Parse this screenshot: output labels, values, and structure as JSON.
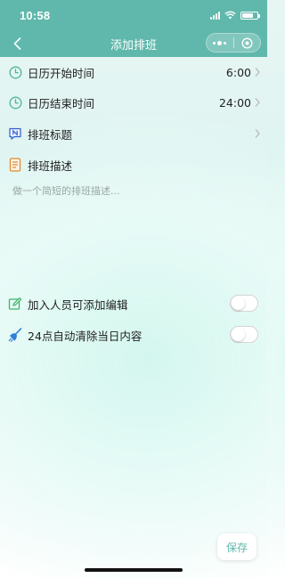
{
  "status_bar": {
    "time": "10:58"
  },
  "nav": {
    "title": "添加排班"
  },
  "rows": {
    "start_time": {
      "label": "日历开始时间",
      "value": "6:00"
    },
    "end_time": {
      "label": "日历结束时间",
      "value": "24:00"
    },
    "schedule_title": {
      "label": "排班标题"
    },
    "schedule_desc": {
      "label": "排班描述",
      "placeholder": "做一个简短的排班描述..."
    }
  },
  "toggles": {
    "members_can_edit": {
      "label": "加入人员可添加编辑",
      "on": false
    },
    "auto_clear": {
      "label": "24点自动清除当日内容",
      "on": false
    }
  },
  "footer": {
    "save_label": "保存"
  },
  "colors": {
    "accent": "#5fb8ab",
    "clock_icon": "#4fb39a",
    "title_icon": "#2f5fd0",
    "desc_icon": "#e08a2c",
    "edit_icon": "#3fb56a",
    "broom_icon": "#2f7fd8"
  }
}
